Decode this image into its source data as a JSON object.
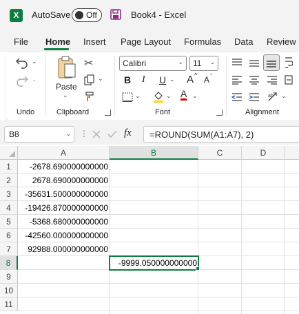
{
  "titlebar": {
    "autosave_label": "AutoSave",
    "autosave_state": "Off",
    "document_title": "Book4  -  Excel",
    "logo_letter": "X"
  },
  "tabs": [
    "File",
    "Home",
    "Insert",
    "Page Layout",
    "Formulas",
    "Data",
    "Review"
  ],
  "active_tab": "Home",
  "ribbon": {
    "undo_group": "Undo",
    "clipboard_group": "Clipboard",
    "paste_label": "Paste",
    "font_group": "Font",
    "font_name": "Calibri",
    "font_size": "11",
    "bold": "B",
    "italic": "I",
    "underline": "U",
    "grow_font": "A",
    "shrink_font": "A",
    "font_color_letter": "A",
    "alignment_group": "Alignment"
  },
  "formula_bar": {
    "name_box": "B8",
    "fx": "fx",
    "formula": "=ROUND(SUM(A1:A7), 2)"
  },
  "grid": {
    "columns": [
      "A",
      "B",
      "C",
      "D"
    ],
    "rows": [
      "1",
      "2",
      "3",
      "4",
      "5",
      "6",
      "7",
      "8",
      "9",
      "10",
      "11"
    ],
    "column_a": [
      "-2678.690000000000",
      "2678.690000000000",
      "-35631.500000000000",
      "-19426.870000000000",
      "-5368.680000000000",
      "-42560.000000000000",
      "92988.000000000000"
    ],
    "b8_value": "-9999.050000000000",
    "selected_cell": "B8"
  },
  "colors": {
    "accent": "#107c41",
    "chrome_bg": "#f3f3f3",
    "gridline": "#e1e1e1"
  }
}
